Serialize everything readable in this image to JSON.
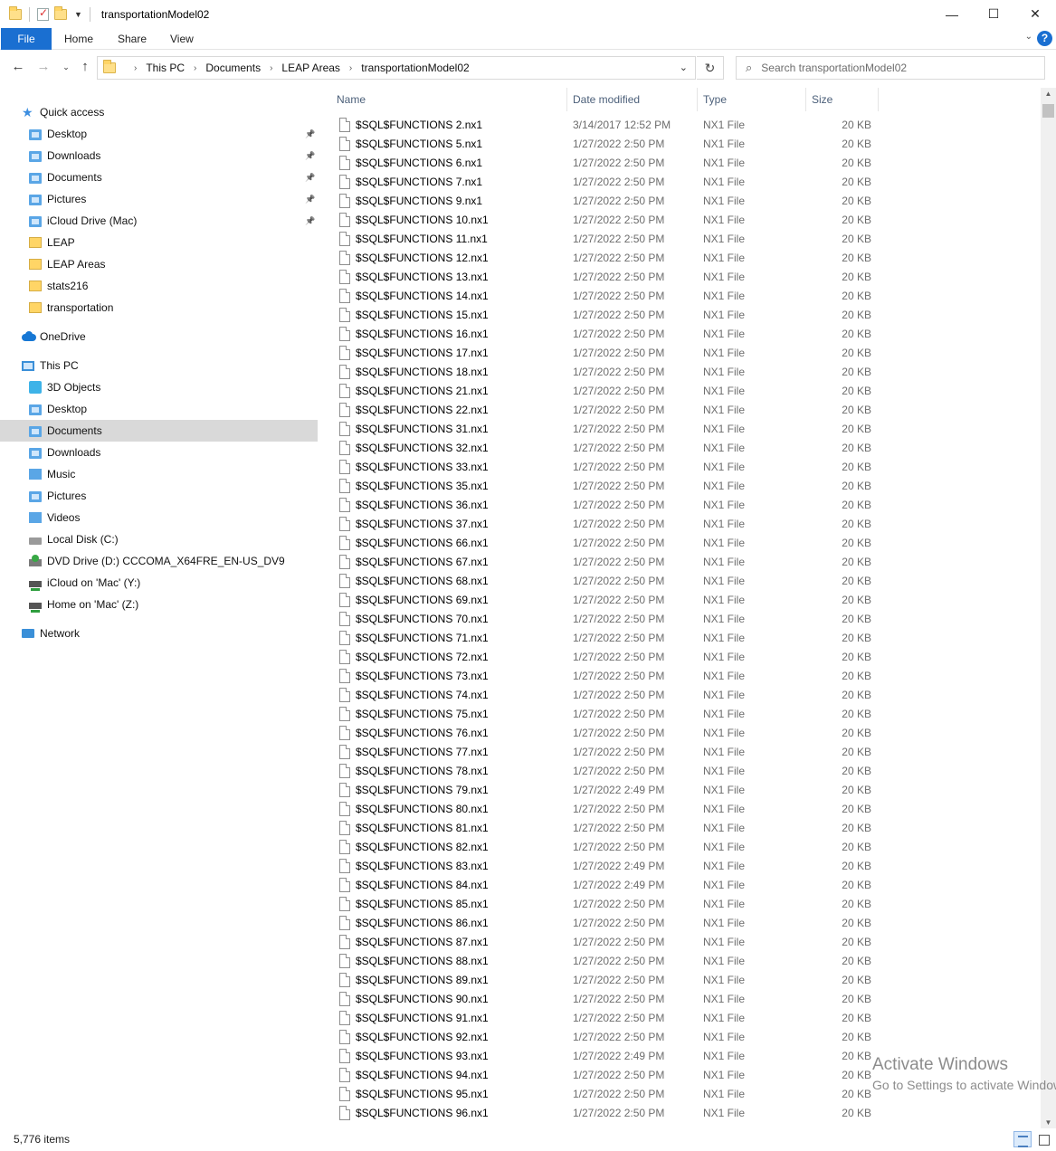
{
  "window": {
    "title": "transportationModel02",
    "minimize_icon": "—",
    "maximize_icon": "☐",
    "close_icon": "✕"
  },
  "ribbon": {
    "tabs": [
      "File",
      "Home",
      "Share",
      "View"
    ],
    "accent_color": "#1a6fd1"
  },
  "address": {
    "crumbs": [
      "This PC",
      "Documents",
      "LEAP Areas",
      "transportationModel02"
    ]
  },
  "search": {
    "placeholder": "Search transportationModel02"
  },
  "sidebar": {
    "items": [
      {
        "label": "Quick access",
        "icon": "star-icon",
        "pinned": false
      },
      {
        "label": "Desktop",
        "icon": "desktop-folder-icon",
        "pinned": true
      },
      {
        "label": "Downloads",
        "icon": "downloads-folder-icon",
        "pinned": true
      },
      {
        "label": "Documents",
        "icon": "documents-folder-icon",
        "pinned": true
      },
      {
        "label": "Pictures",
        "icon": "pictures-folder-icon",
        "pinned": true
      },
      {
        "label": "iCloud Drive (Mac)",
        "icon": "icloud-folder-icon",
        "pinned": true
      },
      {
        "label": "LEAP",
        "icon": "folder-icon",
        "pinned": false
      },
      {
        "label": "LEAP Areas",
        "icon": "folder-icon",
        "pinned": false
      },
      {
        "label": "stats216",
        "icon": "folder-icon",
        "pinned": false
      },
      {
        "label": "transportation",
        "icon": "folder-icon",
        "pinned": false
      },
      {
        "label": "OneDrive",
        "icon": "onedrive-cloud-icon",
        "pinned": false
      },
      {
        "label": "This PC",
        "icon": "this-pc-icon",
        "pinned": false
      },
      {
        "label": "3D Objects",
        "icon": "3d-objects-icon",
        "pinned": false
      },
      {
        "label": "Desktop",
        "icon": "desktop-folder-icon",
        "pinned": false
      },
      {
        "label": "Documents",
        "icon": "documents-folder-icon",
        "pinned": false,
        "selected": true
      },
      {
        "label": "Downloads",
        "icon": "downloads-folder-icon",
        "pinned": false
      },
      {
        "label": "Music",
        "icon": "music-folder-icon",
        "pinned": false
      },
      {
        "label": "Pictures",
        "icon": "pictures-folder-icon",
        "pinned": false
      },
      {
        "label": "Videos",
        "icon": "videos-folder-icon",
        "pinned": false
      },
      {
        "label": "Local Disk (C:)",
        "icon": "local-disk-icon",
        "pinned": false
      },
      {
        "label": "DVD Drive (D:) CCCOMA_X64FRE_EN-US_DV9",
        "icon": "dvd-drive-icon",
        "pinned": false
      },
      {
        "label": "iCloud on 'Mac' (Y:)",
        "icon": "network-drive-icon",
        "pinned": false
      },
      {
        "label": "Home on 'Mac' (Z:)",
        "icon": "network-drive-icon",
        "pinned": false
      },
      {
        "label": "Network",
        "icon": "network-icon",
        "pinned": false
      }
    ]
  },
  "columns": {
    "name": "Name",
    "date": "Date modified",
    "type": "Type",
    "size": "Size"
  },
  "files": [
    {
      "name": "$SQL$FUNCTIONS 2.nx1",
      "date": "3/14/2017 12:52 PM",
      "type": "NX1 File",
      "size": "20 KB"
    },
    {
      "name": "$SQL$FUNCTIONS 5.nx1",
      "date": "1/27/2022 2:50 PM",
      "type": "NX1 File",
      "size": "20 KB"
    },
    {
      "name": "$SQL$FUNCTIONS 6.nx1",
      "date": "1/27/2022 2:50 PM",
      "type": "NX1 File",
      "size": "20 KB"
    },
    {
      "name": "$SQL$FUNCTIONS 7.nx1",
      "date": "1/27/2022 2:50 PM",
      "type": "NX1 File",
      "size": "20 KB"
    },
    {
      "name": "$SQL$FUNCTIONS 9.nx1",
      "date": "1/27/2022 2:50 PM",
      "type": "NX1 File",
      "size": "20 KB"
    },
    {
      "name": "$SQL$FUNCTIONS 10.nx1",
      "date": "1/27/2022 2:50 PM",
      "type": "NX1 File",
      "size": "20 KB"
    },
    {
      "name": "$SQL$FUNCTIONS 11.nx1",
      "date": "1/27/2022 2:50 PM",
      "type": "NX1 File",
      "size": "20 KB"
    },
    {
      "name": "$SQL$FUNCTIONS 12.nx1",
      "date": "1/27/2022 2:50 PM",
      "type": "NX1 File",
      "size": "20 KB"
    },
    {
      "name": "$SQL$FUNCTIONS 13.nx1",
      "date": "1/27/2022 2:50 PM",
      "type": "NX1 File",
      "size": "20 KB"
    },
    {
      "name": "$SQL$FUNCTIONS 14.nx1",
      "date": "1/27/2022 2:50 PM",
      "type": "NX1 File",
      "size": "20 KB"
    },
    {
      "name": "$SQL$FUNCTIONS 15.nx1",
      "date": "1/27/2022 2:50 PM",
      "type": "NX1 File",
      "size": "20 KB"
    },
    {
      "name": "$SQL$FUNCTIONS 16.nx1",
      "date": "1/27/2022 2:50 PM",
      "type": "NX1 File",
      "size": "20 KB"
    },
    {
      "name": "$SQL$FUNCTIONS 17.nx1",
      "date": "1/27/2022 2:50 PM",
      "type": "NX1 File",
      "size": "20 KB"
    },
    {
      "name": "$SQL$FUNCTIONS 18.nx1",
      "date": "1/27/2022 2:50 PM",
      "type": "NX1 File",
      "size": "20 KB"
    },
    {
      "name": "$SQL$FUNCTIONS 21.nx1",
      "date": "1/27/2022 2:50 PM",
      "type": "NX1 File",
      "size": "20 KB"
    },
    {
      "name": "$SQL$FUNCTIONS 22.nx1",
      "date": "1/27/2022 2:50 PM",
      "type": "NX1 File",
      "size": "20 KB"
    },
    {
      "name": "$SQL$FUNCTIONS 31.nx1",
      "date": "1/27/2022 2:50 PM",
      "type": "NX1 File",
      "size": "20 KB"
    },
    {
      "name": "$SQL$FUNCTIONS 32.nx1",
      "date": "1/27/2022 2:50 PM",
      "type": "NX1 File",
      "size": "20 KB"
    },
    {
      "name": "$SQL$FUNCTIONS 33.nx1",
      "date": "1/27/2022 2:50 PM",
      "type": "NX1 File",
      "size": "20 KB"
    },
    {
      "name": "$SQL$FUNCTIONS 35.nx1",
      "date": "1/27/2022 2:50 PM",
      "type": "NX1 File",
      "size": "20 KB"
    },
    {
      "name": "$SQL$FUNCTIONS 36.nx1",
      "date": "1/27/2022 2:50 PM",
      "type": "NX1 File",
      "size": "20 KB"
    },
    {
      "name": "$SQL$FUNCTIONS 37.nx1",
      "date": "1/27/2022 2:50 PM",
      "type": "NX1 File",
      "size": "20 KB"
    },
    {
      "name": "$SQL$FUNCTIONS 66.nx1",
      "date": "1/27/2022 2:50 PM",
      "type": "NX1 File",
      "size": "20 KB"
    },
    {
      "name": "$SQL$FUNCTIONS 67.nx1",
      "date": "1/27/2022 2:50 PM",
      "type": "NX1 File",
      "size": "20 KB"
    },
    {
      "name": "$SQL$FUNCTIONS 68.nx1",
      "date": "1/27/2022 2:50 PM",
      "type": "NX1 File",
      "size": "20 KB"
    },
    {
      "name": "$SQL$FUNCTIONS 69.nx1",
      "date": "1/27/2022 2:50 PM",
      "type": "NX1 File",
      "size": "20 KB"
    },
    {
      "name": "$SQL$FUNCTIONS 70.nx1",
      "date": "1/27/2022 2:50 PM",
      "type": "NX1 File",
      "size": "20 KB"
    },
    {
      "name": "$SQL$FUNCTIONS 71.nx1",
      "date": "1/27/2022 2:50 PM",
      "type": "NX1 File",
      "size": "20 KB"
    },
    {
      "name": "$SQL$FUNCTIONS 72.nx1",
      "date": "1/27/2022 2:50 PM",
      "type": "NX1 File",
      "size": "20 KB"
    },
    {
      "name": "$SQL$FUNCTIONS 73.nx1",
      "date": "1/27/2022 2:50 PM",
      "type": "NX1 File",
      "size": "20 KB"
    },
    {
      "name": "$SQL$FUNCTIONS 74.nx1",
      "date": "1/27/2022 2:50 PM",
      "type": "NX1 File",
      "size": "20 KB"
    },
    {
      "name": "$SQL$FUNCTIONS 75.nx1",
      "date": "1/27/2022 2:50 PM",
      "type": "NX1 File",
      "size": "20 KB"
    },
    {
      "name": "$SQL$FUNCTIONS 76.nx1",
      "date": "1/27/2022 2:50 PM",
      "type": "NX1 File",
      "size": "20 KB"
    },
    {
      "name": "$SQL$FUNCTIONS 77.nx1",
      "date": "1/27/2022 2:50 PM",
      "type": "NX1 File",
      "size": "20 KB"
    },
    {
      "name": "$SQL$FUNCTIONS 78.nx1",
      "date": "1/27/2022 2:50 PM",
      "type": "NX1 File",
      "size": "20 KB"
    },
    {
      "name": "$SQL$FUNCTIONS 79.nx1",
      "date": "1/27/2022 2:49 PM",
      "type": "NX1 File",
      "size": "20 KB"
    },
    {
      "name": "$SQL$FUNCTIONS 80.nx1",
      "date": "1/27/2022 2:50 PM",
      "type": "NX1 File",
      "size": "20 KB"
    },
    {
      "name": "$SQL$FUNCTIONS 81.nx1",
      "date": "1/27/2022 2:50 PM",
      "type": "NX1 File",
      "size": "20 KB"
    },
    {
      "name": "$SQL$FUNCTIONS 82.nx1",
      "date": "1/27/2022 2:50 PM",
      "type": "NX1 File",
      "size": "20 KB"
    },
    {
      "name": "$SQL$FUNCTIONS 83.nx1",
      "date": "1/27/2022 2:49 PM",
      "type": "NX1 File",
      "size": "20 KB"
    },
    {
      "name": "$SQL$FUNCTIONS 84.nx1",
      "date": "1/27/2022 2:49 PM",
      "type": "NX1 File",
      "size": "20 KB"
    },
    {
      "name": "$SQL$FUNCTIONS 85.nx1",
      "date": "1/27/2022 2:50 PM",
      "type": "NX1 File",
      "size": "20 KB"
    },
    {
      "name": "$SQL$FUNCTIONS 86.nx1",
      "date": "1/27/2022 2:50 PM",
      "type": "NX1 File",
      "size": "20 KB"
    },
    {
      "name": "$SQL$FUNCTIONS 87.nx1",
      "date": "1/27/2022 2:50 PM",
      "type": "NX1 File",
      "size": "20 KB"
    },
    {
      "name": "$SQL$FUNCTIONS 88.nx1",
      "date": "1/27/2022 2:50 PM",
      "type": "NX1 File",
      "size": "20 KB"
    },
    {
      "name": "$SQL$FUNCTIONS 89.nx1",
      "date": "1/27/2022 2:50 PM",
      "type": "NX1 File",
      "size": "20 KB"
    },
    {
      "name": "$SQL$FUNCTIONS 90.nx1",
      "date": "1/27/2022 2:50 PM",
      "type": "NX1 File",
      "size": "20 KB"
    },
    {
      "name": "$SQL$FUNCTIONS 91.nx1",
      "date": "1/27/2022 2:50 PM",
      "type": "NX1 File",
      "size": "20 KB"
    },
    {
      "name": "$SQL$FUNCTIONS 92.nx1",
      "date": "1/27/2022 2:50 PM",
      "type": "NX1 File",
      "size": "20 KB"
    },
    {
      "name": "$SQL$FUNCTIONS 93.nx1",
      "date": "1/27/2022 2:49 PM",
      "type": "NX1 File",
      "size": "20 KB"
    },
    {
      "name": "$SQL$FUNCTIONS 94.nx1",
      "date": "1/27/2022 2:50 PM",
      "type": "NX1 File",
      "size": "20 KB"
    },
    {
      "name": "$SQL$FUNCTIONS 95.nx1",
      "date": "1/27/2022 2:50 PM",
      "type": "NX1 File",
      "size": "20 KB"
    },
    {
      "name": "$SQL$FUNCTIONS 96.nx1",
      "date": "1/27/2022 2:50 PM",
      "type": "NX1 File",
      "size": "20 KB"
    }
  ],
  "watermark": {
    "line1": "Activate Windows",
    "line2": "Go to Settings to activate Windows."
  },
  "status": {
    "item_count": "5,776 items"
  }
}
